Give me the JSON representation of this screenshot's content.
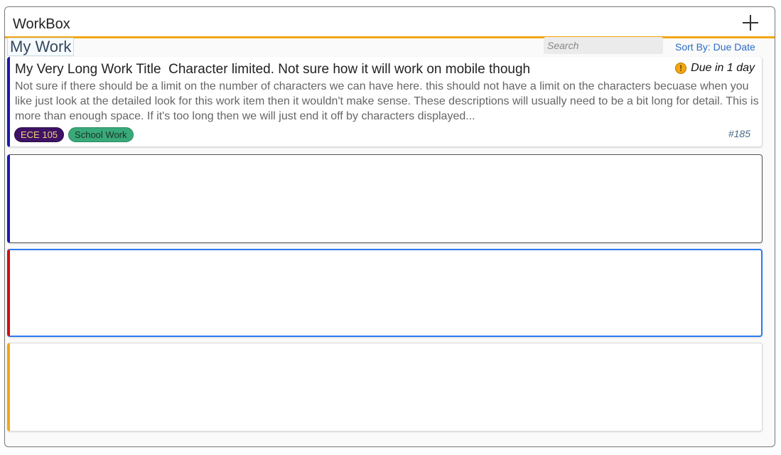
{
  "app": {
    "title": "WorkBox"
  },
  "header": {
    "section_title": "My Work",
    "search_placeholder": "Search",
    "sort_label": "Sort By: Due Date"
  },
  "work_items": [
    {
      "title": "My Very Long Work Title  Character limited. Not sure how it will work on mobile though",
      "due": "Due in 1 day",
      "description": "Not sure if there should be a limit on the number of characters we can have here. this should not have a limit on the characters becuase when you like just look at the detailed look for this work item then it wouldn't make sense. These descriptions will usually need to be a bit long for detail. This is more than enough space. If it's too long then we will just end it off by characters displayed...",
      "tags": [
        "ECE 105",
        "School Work"
      ],
      "number": "#185",
      "accent": "#1a1aad"
    },
    {
      "accent": "#1a1aad"
    },
    {
      "accent": "#d10f0f"
    },
    {
      "accent": "#f3a712"
    }
  ],
  "colors": {
    "header_accent": "#f3a712",
    "link": "#2b6cc4",
    "selected_border": "#2b7af0"
  },
  "icons": {
    "add": "plus-icon",
    "due_warning": "warning-icon"
  }
}
